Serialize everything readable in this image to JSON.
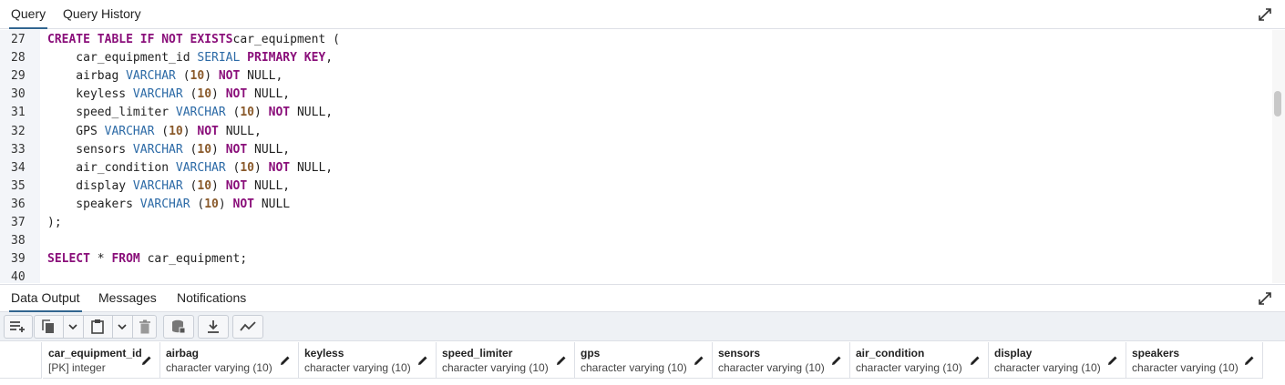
{
  "top_tabs": [
    "Query",
    "Query History"
  ],
  "editor": {
    "lines": [
      {
        "num": "27",
        "tokens": [
          [
            "kw",
            "CREATE TABLE IF NOT EXISTS"
          ],
          [
            "",
            "car_equipment ("
          ]
        ]
      },
      {
        "num": "28",
        "tokens": [
          [
            "",
            "    car_equipment_id "
          ],
          [
            "ty",
            "SERIAL"
          ],
          [
            "",
            ""
          ],
          [
            "kw",
            " PRIMARY KEY"
          ],
          [
            "",
            ","
          ]
        ]
      },
      {
        "num": "29",
        "tokens": [
          [
            "",
            "    airbag "
          ],
          [
            "ty",
            "VARCHAR"
          ],
          [
            "",
            " ("
          ],
          [
            "nm",
            "10"
          ],
          [
            "",
            ") "
          ],
          [
            "kw",
            "NOT"
          ],
          [
            "",
            " NULL,"
          ]
        ]
      },
      {
        "num": "30",
        "tokens": [
          [
            "",
            "    keyless "
          ],
          [
            "ty",
            "VARCHAR"
          ],
          [
            "",
            " ("
          ],
          [
            "nm",
            "10"
          ],
          [
            "",
            ") "
          ],
          [
            "kw",
            "NOT"
          ],
          [
            "",
            " NULL,"
          ]
        ]
      },
      {
        "num": "31",
        "tokens": [
          [
            "",
            "    speed_limiter "
          ],
          [
            "ty",
            "VARCHAR"
          ],
          [
            "",
            " ("
          ],
          [
            "nm",
            "10"
          ],
          [
            "",
            ") "
          ],
          [
            "kw",
            "NOT"
          ],
          [
            "",
            " NULL,"
          ]
        ]
      },
      {
        "num": "32",
        "tokens": [
          [
            "",
            "    GPS "
          ],
          [
            "ty",
            "VARCHAR"
          ],
          [
            "",
            " ("
          ],
          [
            "nm",
            "10"
          ],
          [
            "",
            ") "
          ],
          [
            "kw",
            "NOT"
          ],
          [
            "",
            " NULL,"
          ]
        ]
      },
      {
        "num": "33",
        "tokens": [
          [
            "",
            "    sensors "
          ],
          [
            "ty",
            "VARCHAR"
          ],
          [
            "",
            " ("
          ],
          [
            "nm",
            "10"
          ],
          [
            "",
            ") "
          ],
          [
            "kw",
            "NOT"
          ],
          [
            "",
            " NULL,"
          ]
        ]
      },
      {
        "num": "34",
        "tokens": [
          [
            "",
            "    air_condition "
          ],
          [
            "ty",
            "VARCHAR"
          ],
          [
            "",
            " ("
          ],
          [
            "nm",
            "10"
          ],
          [
            "",
            ") "
          ],
          [
            "kw",
            "NOT"
          ],
          [
            "",
            " NULL,"
          ]
        ]
      },
      {
        "num": "35",
        "tokens": [
          [
            "",
            "    display "
          ],
          [
            "ty",
            "VARCHAR"
          ],
          [
            "",
            " ("
          ],
          [
            "nm",
            "10"
          ],
          [
            "",
            ") "
          ],
          [
            "kw",
            "NOT"
          ],
          [
            "",
            " NULL,"
          ]
        ]
      },
      {
        "num": "36",
        "tokens": [
          [
            "",
            "    speakers "
          ],
          [
            "ty",
            "VARCHAR"
          ],
          [
            "",
            " ("
          ],
          [
            "nm",
            "10"
          ],
          [
            "",
            ") "
          ],
          [
            "kw",
            "NOT"
          ],
          [
            "",
            " NULL"
          ]
        ]
      },
      {
        "num": "37",
        "tokens": [
          [
            "",
            ");"
          ]
        ]
      },
      {
        "num": "38",
        "tokens": []
      },
      {
        "num": "39",
        "tokens": [
          [
            "kw",
            "SELECT"
          ],
          [
            "",
            " * "
          ],
          [
            "kw",
            "FROM"
          ],
          [
            "",
            " car_equipment;"
          ]
        ]
      },
      {
        "num": "40",
        "tokens": []
      }
    ]
  },
  "bottom_tabs": [
    "Data Output",
    "Messages",
    "Notifications"
  ],
  "toolbar": {
    "buttons": [
      "add-row",
      "copy",
      "copy-dropdown",
      "paste",
      "paste-dropdown",
      "delete",
      "save-data",
      "download",
      "graph"
    ]
  },
  "grid": {
    "columns": [
      {
        "name": "car_equipment_id",
        "type": "[PK] integer"
      },
      {
        "name": "airbag",
        "type": "character varying (10)"
      },
      {
        "name": "keyless",
        "type": "character varying (10)"
      },
      {
        "name": "speed_limiter",
        "type": "character varying (10)"
      },
      {
        "name": "gps",
        "type": "character varying (10)"
      },
      {
        "name": "sensors",
        "type": "character varying (10)"
      },
      {
        "name": "air_condition",
        "type": "character varying (10)"
      },
      {
        "name": "display",
        "type": "character varying (10)"
      },
      {
        "name": "speakers",
        "type": "character varying (10)"
      }
    ]
  },
  "colors": {
    "accent": "#326690",
    "keyword": "#8a0f7a",
    "type": "#2c6aa6",
    "number": "#8a5a2b"
  }
}
